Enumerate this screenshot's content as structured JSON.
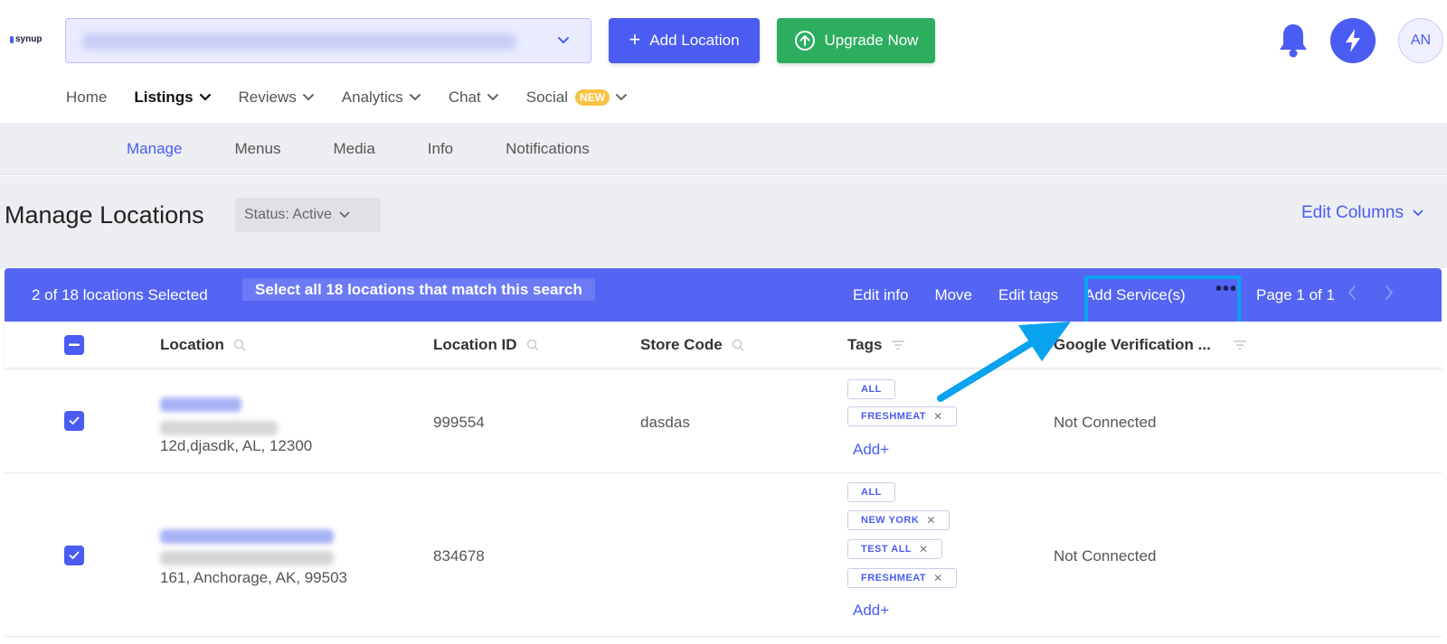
{
  "header": {
    "logo_text": "synup",
    "add_location_label": "Add Location",
    "upgrade_label": "Upgrade Now",
    "avatar_initials": "AN"
  },
  "main_nav": [
    {
      "label": "Home",
      "dropdown": false,
      "active": false
    },
    {
      "label": "Listings",
      "dropdown": true,
      "active": true
    },
    {
      "label": "Reviews",
      "dropdown": true,
      "active": false
    },
    {
      "label": "Analytics",
      "dropdown": true,
      "active": false
    },
    {
      "label": "Chat",
      "dropdown": true,
      "active": false
    },
    {
      "label": "Social",
      "dropdown": true,
      "active": false,
      "badge": "NEW"
    }
  ],
  "sub_nav": [
    {
      "label": "Manage",
      "active": true
    },
    {
      "label": "Menus",
      "active": false
    },
    {
      "label": "Media",
      "active": false
    },
    {
      "label": "Info",
      "active": false
    },
    {
      "label": "Notifications",
      "active": false
    }
  ],
  "page": {
    "title": "Manage Locations",
    "status_filter": "Status: Active",
    "edit_columns_label": "Edit Columns"
  },
  "selection_bar": {
    "count_text": "2 of 18 locations Selected",
    "select_all_text": "Select all 18 locations that match this search",
    "actions": [
      "Edit info",
      "Move",
      "Edit tags",
      "Add Service(s)"
    ],
    "more": "•••",
    "page_text": "Page 1 of 1"
  },
  "table": {
    "columns": [
      "Location",
      "Location ID",
      "Store Code",
      "Tags",
      "Google Verification ..."
    ],
    "add_tag_label": "Add+",
    "rows": [
      {
        "checked": true,
        "address": "12d,djasdk, AL, 12300",
        "location_id": "999554",
        "store_code": "dasdas",
        "tags": [
          {
            "label": "ALL",
            "removable": false
          },
          {
            "label": "FRESHMEAT",
            "removable": true
          }
        ],
        "google_verification": "Not Connected"
      },
      {
        "checked": true,
        "address": "161, Anchorage, AK, 99503",
        "location_id": "834678",
        "store_code": "",
        "tags": [
          {
            "label": "ALL",
            "removable": false
          },
          {
            "label": "NEW YORK",
            "removable": true
          },
          {
            "label": "TEST ALL",
            "removable": true
          },
          {
            "label": "FRESHMEAT",
            "removable": true
          }
        ],
        "google_verification": "Not Connected"
      }
    ]
  },
  "colors": {
    "primary": "#4a5cf2",
    "success": "#2cae5e",
    "selection_bar": "#5465f4",
    "highlight": "#0aa3ef",
    "badge": "#f7c245"
  }
}
